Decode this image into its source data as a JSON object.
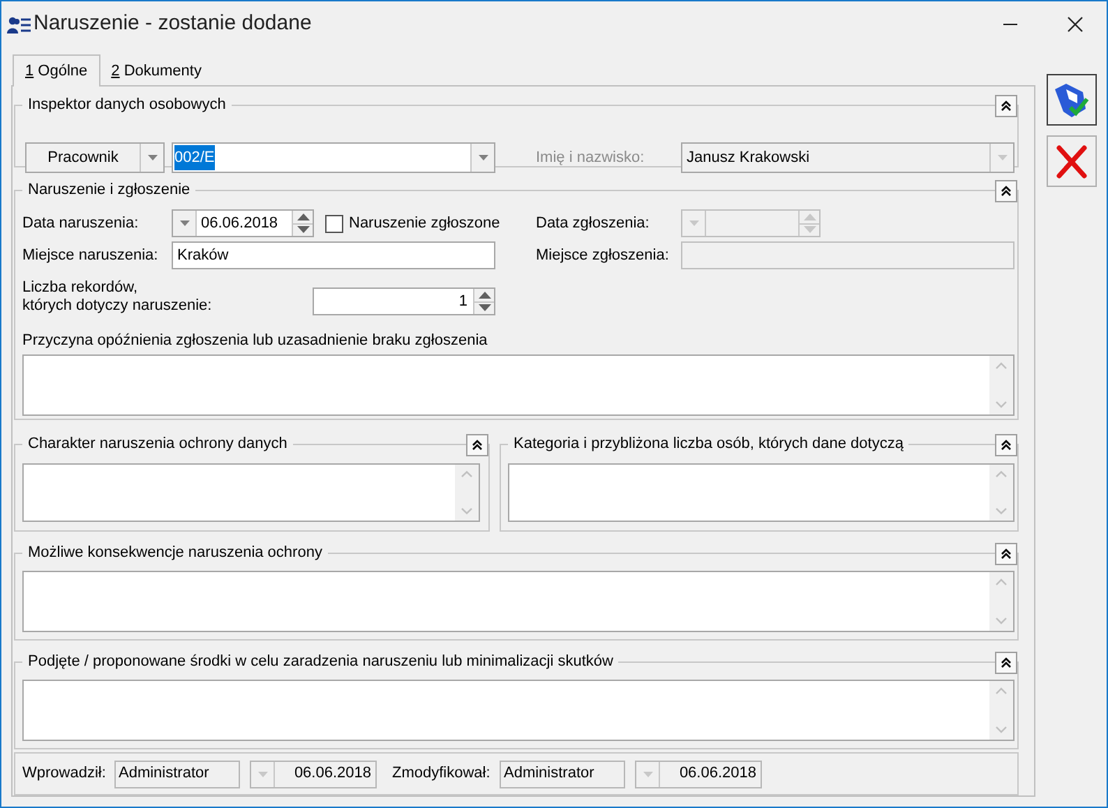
{
  "window": {
    "title": "Naruszenie - zostanie dodane"
  },
  "tabs": [
    {
      "key": "1",
      "label": "Ogólne",
      "selected": true
    },
    {
      "key": "2",
      "label": "Dokumenty",
      "selected": false
    }
  ],
  "inspector": {
    "title": "Inspektor danych osobowych",
    "expanded": true,
    "type": "Pracownik",
    "code": "002/E",
    "code_selected": true,
    "name_label": "Imię i nazwisko:",
    "name_value": "Janusz Krakowski",
    "name_disabled": true
  },
  "breach": {
    "title": "Naruszenie i zgłoszenie",
    "expanded": true,
    "date_label": "Data naruszenia:",
    "date": "06.06.2018",
    "reported_label": "Naruszenie zgłoszone",
    "reported": false,
    "report_date_label": "Data zgłoszenia:",
    "place_label": "Miejsce naruszenia:",
    "place": "Kraków",
    "report_place_label": "Miejsce zgłoszenia:",
    "records_label": "Liczba rekordów,\nktórych dotyczy naruszenie:",
    "records": "1",
    "reason_label": "Przyczyna opóźnienia zgłoszenia lub uzasadnienie braku zgłoszenia"
  },
  "nature": {
    "title": "Charakter naruszenia ochrony danych",
    "expanded": true
  },
  "category": {
    "title": "Kategoria i przybliżona liczba osób, których dane dotyczą",
    "expanded": true
  },
  "consequences": {
    "title": "Możliwe konsekwencje naruszenia ochrony",
    "expanded": true
  },
  "measures": {
    "title": "Podjęte / proponowane środki w celu zaradzenia naruszeniu lub minimalizacji skutków",
    "expanded": true
  },
  "footer": {
    "created_label": "Wprowadził:",
    "created_by": "Administrator",
    "created_date": "06.06.2018",
    "modified_label": "Zmodyfikował:",
    "modified_by": "Administrator",
    "modified_date": "06.06.2018"
  }
}
